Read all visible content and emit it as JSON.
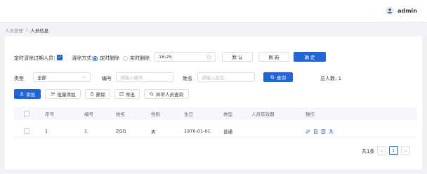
{
  "header": {
    "username": "admin"
  },
  "breadcrumb": {
    "parent": "人员管理",
    "sep": "/",
    "current": "人员信息"
  },
  "schedule": {
    "label": "定时清除过期人员：",
    "mode_label": "清除方式：",
    "opt_timed": "定时删除",
    "opt_realtime": "实时删除",
    "time_value": "16:25",
    "btn_default": "默 认",
    "btn_refresh": "刷 新",
    "btn_confirm": "确 定"
  },
  "filters": {
    "type_label": "类型",
    "type_value": "全部",
    "id_label": "编号",
    "id_placeholder": "请输入编号",
    "name_label": "姓名",
    "name_placeholder": "请输入姓名",
    "search_label": "查询",
    "total_label": "总人数: 1"
  },
  "toolbar": {
    "add": "添加",
    "batch_add": "批量添加",
    "delete": "删除",
    "export": "导出",
    "abnormal": "异常人员查询"
  },
  "table": {
    "columns": [
      "序号",
      "编号",
      "姓名",
      "性别",
      "生日",
      "类型",
      "人员有效期",
      "操作"
    ],
    "rows": [
      {
        "seq": "1",
        "id": "1",
        "name": "ZGG",
        "gender": "男",
        "birthday": "1970-01-01",
        "type": "普通",
        "validity": ""
      }
    ]
  },
  "pagination": {
    "total": "共1条",
    "prev": "<",
    "page": "1",
    "next": ">"
  },
  "colors": {
    "primary": "#1f67d8"
  }
}
